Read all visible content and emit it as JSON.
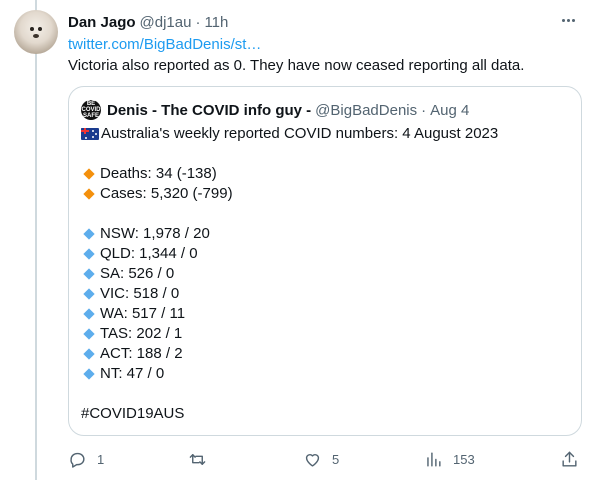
{
  "tweet": {
    "author_name": "Dan Jago",
    "author_handle": "@dj1au",
    "separator": "·",
    "time": "11h",
    "link_text": "twitter.com/BigBadDenis/st…",
    "text": "Victoria also reported as 0. They have now ceased reporting all data."
  },
  "quote": {
    "avatar_text": "BE COVID SAFE",
    "author_name": "Denis - The COVID info guy -",
    "author_handle": "@BigBadDenis",
    "separator": "·",
    "time": "Aug 4",
    "headline": "Australia's weekly reported COVID numbers: 4 August 2023",
    "headline_icon": "australia-flag-icon",
    "summary": [
      {
        "text": "Deaths: 34 (-138)",
        "icon": "orange-diamond",
        "color": "#f4900c"
      },
      {
        "text": "Cases: 5,320 (-799)",
        "icon": "orange-diamond",
        "color": "#f4900c"
      }
    ],
    "states": [
      {
        "text": "NSW: 1,978 / 20"
      },
      {
        "text": "QLD: 1,344 / 0"
      },
      {
        "text": "SA: 526 / 0"
      },
      {
        "text": "VIC: 518 / 0"
      },
      {
        "text": "WA: 517 / 11"
      },
      {
        "text": "TAS: 202 / 1"
      },
      {
        "text": "ACT: 188 / 2"
      },
      {
        "text": "NT: 47 / 0"
      }
    ],
    "state_bullet_color": "#5dadec",
    "hashtag": "#COVID19AUS"
  },
  "actions": {
    "reply_count": "1",
    "retweet_count": "",
    "like_count": "5",
    "views_count": "153"
  },
  "colors": {
    "link": "#1d9bf0",
    "muted": "#536471",
    "border": "#cfd9de"
  }
}
